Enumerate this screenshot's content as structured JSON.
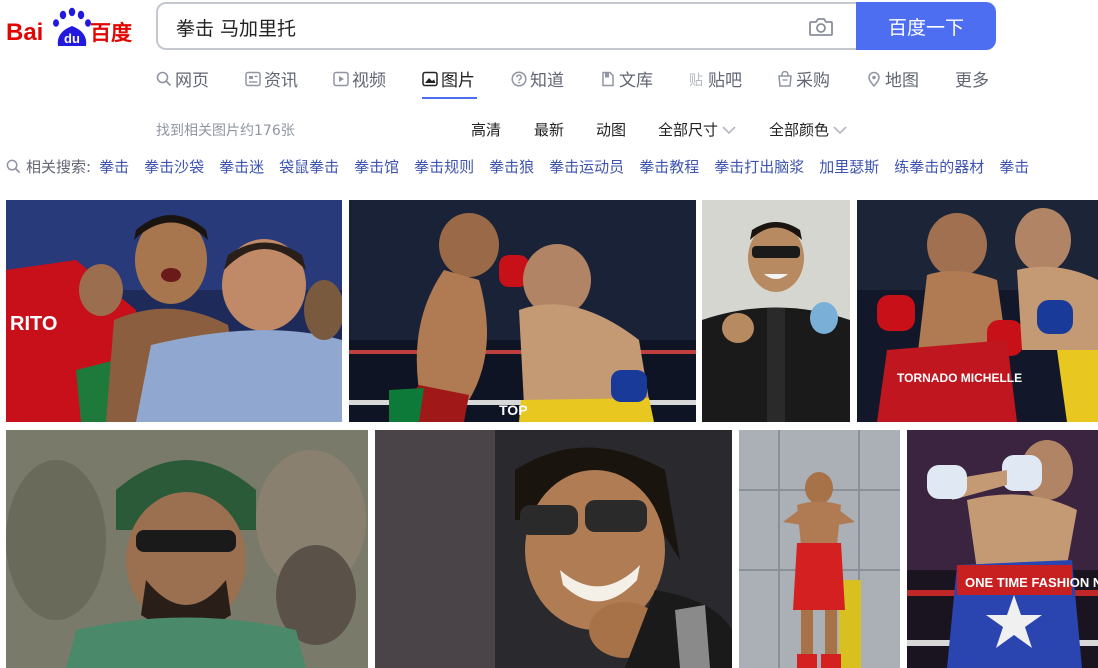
{
  "logo": {
    "text_bai": "Bai",
    "text_du": "du",
    "text_cn": "百度"
  },
  "search": {
    "query": "拳击 马加里托",
    "button_label": "百度一下",
    "camera_icon": "camera-icon"
  },
  "nav": {
    "items": [
      {
        "label": "网页",
        "icon": "search-icon"
      },
      {
        "label": "资讯",
        "icon": "news-icon"
      },
      {
        "label": "视频",
        "icon": "video-icon"
      },
      {
        "label": "图片",
        "icon": "image-icon",
        "active": true
      },
      {
        "label": "知道",
        "icon": "question-icon"
      },
      {
        "label": "文库",
        "icon": "document-icon"
      },
      {
        "label": "贴吧",
        "icon": "tieba-icon"
      },
      {
        "label": "采购",
        "icon": "shop-icon"
      },
      {
        "label": "地图",
        "icon": "map-icon"
      },
      {
        "label": "更多",
        "icon": ""
      }
    ],
    "active_color": "#4e6ef2"
  },
  "results": {
    "count_text": "找到相关图片约176张"
  },
  "filters": [
    "高清",
    "最新",
    "动图",
    "全部尺寸",
    "全部颜色"
  ],
  "related": {
    "label": "相关搜索:",
    "items": [
      "拳击",
      "拳击沙袋",
      "拳击迷",
      "袋鼠拳击",
      "拳击馆",
      "拳击规则",
      "拳击狼",
      "拳击运动员",
      "拳击教程",
      "拳击打出脑浆",
      "加里瑟斯",
      "练拳击的器材",
      "拳击"
    ]
  },
  "images": [
    {
      "name": "boxer-corner-referee",
      "caption": "RITO"
    },
    {
      "name": "boxers-exchange-punches",
      "caption": "TOP"
    },
    {
      "name": "boxer-sunglasses-jacket",
      "caption": ""
    },
    {
      "name": "boxers-clinch-tornado",
      "caption": "TORNADO MICHELLE"
    },
    {
      "name": "boxer-green-beanie",
      "caption": ""
    },
    {
      "name": "boxer-smiling-sunglasses",
      "caption": ""
    },
    {
      "name": "boxer-weigh-in",
      "caption": ""
    },
    {
      "name": "boxer-one-time-trunks",
      "caption": "ONE TIME FASHION NOVA"
    }
  ],
  "colors": {
    "brand_blue": "#4e6ef2",
    "brand_red": "#e10602",
    "link": "#3e54b0"
  }
}
